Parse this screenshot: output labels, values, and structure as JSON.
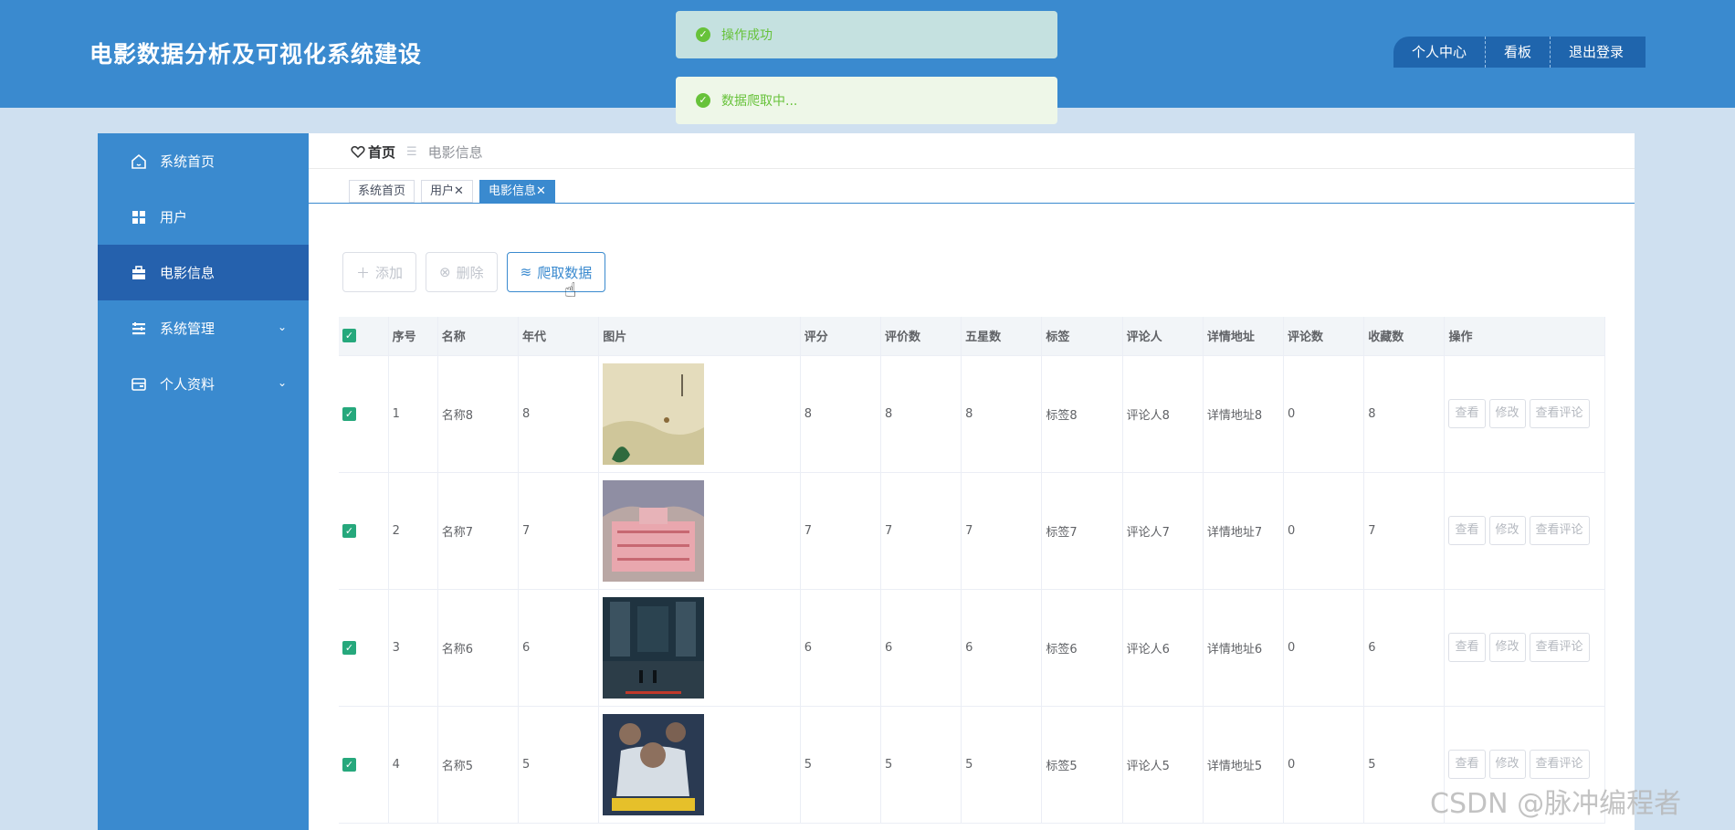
{
  "header": {
    "title": "电影数据分析及可视化系统建设",
    "nav": [
      "个人中心",
      "看板",
      "退出登录"
    ]
  },
  "toasts": {
    "success": "操作成功",
    "loading": "数据爬取中..."
  },
  "sidebar": {
    "items": [
      {
        "label": "系统首页",
        "icon": "home-icon"
      },
      {
        "label": "用户",
        "icon": "grid-icon"
      },
      {
        "label": "电影信息",
        "icon": "briefcase-icon",
        "active": true
      },
      {
        "label": "系统管理",
        "icon": "list-icon",
        "expandable": true
      },
      {
        "label": "个人资料",
        "icon": "card-icon",
        "expandable": true
      }
    ]
  },
  "breadcrumb": {
    "home": "首页",
    "current": "电影信息"
  },
  "tabs": [
    {
      "label": "系统首页"
    },
    {
      "label": "用户",
      "closable": true
    },
    {
      "label": "电影信息",
      "closable": true,
      "active": true
    }
  ],
  "toolbar": {
    "add": "添加",
    "delete": "删除",
    "crawl": "爬取数据"
  },
  "table": {
    "columns": [
      "序号",
      "名称",
      "年代",
      "图片",
      "评分",
      "评价数",
      "五星数",
      "标签",
      "评论人",
      "详情地址",
      "评论数",
      "收藏数",
      "操作"
    ],
    "rows": [
      {
        "idx": "1",
        "name": "名称8",
        "year": "8",
        "score": "8",
        "reviews": "8",
        "five": "8",
        "tag": "标签8",
        "reviewer": "评论人8",
        "url": "详情地址8",
        "comments": "0",
        "favs": "8"
      },
      {
        "idx": "2",
        "name": "名称7",
        "year": "7",
        "score": "7",
        "reviews": "7",
        "five": "7",
        "tag": "标签7",
        "reviewer": "评论人7",
        "url": "详情地址7",
        "comments": "0",
        "favs": "7"
      },
      {
        "idx": "3",
        "name": "名称6",
        "year": "6",
        "score": "6",
        "reviews": "6",
        "five": "6",
        "tag": "标签6",
        "reviewer": "评论人6",
        "url": "详情地址6",
        "comments": "0",
        "favs": "6"
      },
      {
        "idx": "4",
        "name": "名称5",
        "year": "5",
        "score": "5",
        "reviews": "5",
        "five": "5",
        "tag": "标签5",
        "reviewer": "评论人5",
        "url": "详情地址5",
        "comments": "0",
        "favs": "5"
      }
    ],
    "ops": [
      "查看",
      "修改",
      "查看评论"
    ]
  },
  "watermark": "CSDN @脉冲编程者",
  "colors": {
    "primary": "#3a8acf",
    "sidebar_active": "#2561ad",
    "checkbox": "#26a87c",
    "toast_text": "#67c23a"
  }
}
